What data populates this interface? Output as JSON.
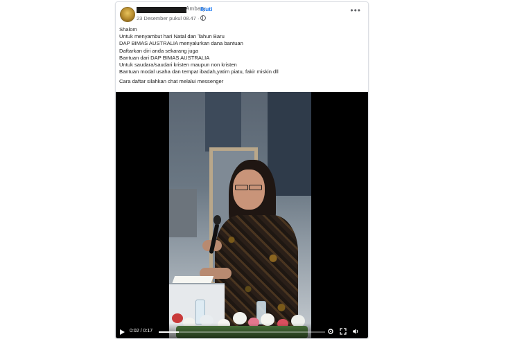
{
  "post": {
    "author_visible": "Ambary",
    "follow_label": "Ikuti",
    "date": "23 Desember pukul 08.47 ·",
    "privacy_icon": "globe-icon",
    "more_icon": "more-options-icon"
  },
  "text_lines": [
    "Shalom",
    "Untuk menyambut hari Natal dan Tahun Baru",
    "DAP BIMAS AUSTRALIA menyalurkan dana bantuan",
    "Daftarkan diri anda sekarang juga",
    "Bantuan dari DAP BIMAS AUSTRALIA",
    "Untuk saudara/saudari kristen maupun non kristen",
    "Bantuan modal usaha dan tempat ibadah,yatim piatu, fakir miskin dll"
  ],
  "text_footer": "Cara daftar silahkan chat melalui messenger",
  "video": {
    "time": "0:02 / 0:17",
    "progress_fraction": 0.12,
    "icons": [
      "play-icon",
      "settings-icon",
      "fullscreen-icon",
      "volume-icon"
    ]
  },
  "colors": {
    "follow_link": "#1877f2",
    "meta_text": "#65676b",
    "video_background": "#000000"
  }
}
